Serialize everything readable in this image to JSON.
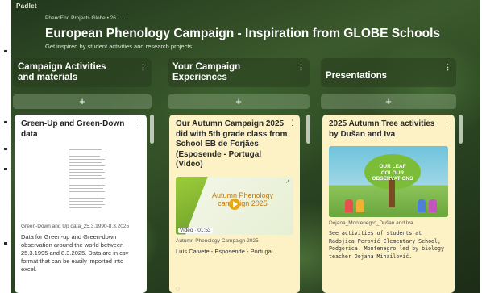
{
  "app": {
    "brand": "Padlet",
    "breadcrumb": "PhenoEnd Projects Globe • 26 · ...",
    "title": "European Phenology Campaign - Inspiration from GLOBE Schools",
    "subtitle": "Get inspired by student activities and research projects"
  },
  "columns": [
    {
      "title_line1": "Campaign Activities",
      "title_line2": "and materials",
      "menu": "⋮",
      "add": "+"
    },
    {
      "title_line1": "Your Campaign",
      "title_line2": "Experiences",
      "menu": "⋮",
      "add": "+"
    },
    {
      "title_line1": "Presentations",
      "title_line2": "",
      "menu": "⋮",
      "add": "+"
    }
  ],
  "cards": {
    "greenup": {
      "title": "Green-Up and Green-Down data",
      "attachment": "Green-Down and Up data_25.3.1990-8.3.2025",
      "body": "Data for Green-up and Green-down observation around the world between 25.3.1995 and 8.3.2025. Data are in csv format that can be easily imported into excel."
    },
    "autumn": {
      "title": "Our Autumn Campaign 2025 did with 5th grade class from School EB de Forjães (Esposende - Portugal (Video)",
      "video_text": "Autumn Phenology campaign 2025",
      "video_badge": "Video · 01:53",
      "meta_line1": "Autumn Phenology Campaign 2025",
      "meta_line2": "Luís Calvete - Esposende - Portugal"
    },
    "tree": {
      "title": "2025 Autumn Tree activities by Dušan and Iva",
      "illus_sign": "OUR LEAF COLOUR OBSERVATIONS",
      "caption": "Dojana_Montenegro_Dušan and Iva",
      "body": "See activities of students at Radojica Perović Elementary School, Podgorica, Montenegro led by biology teacher Dojana Mihailović."
    }
  },
  "colors": {
    "accent_yellow": "#fdf2c5",
    "card_white": "#ffffff",
    "header_text": "#ffffff",
    "play_button": "#e6a814"
  }
}
